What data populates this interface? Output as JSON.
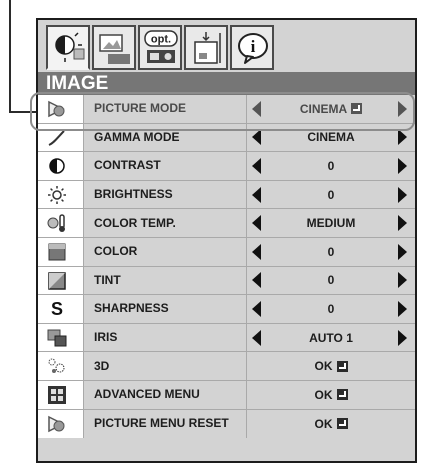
{
  "tabs": [
    {
      "name": "image-tab-icon",
      "active": true
    },
    {
      "name": "screen-tab-icon",
      "active": false
    },
    {
      "name": "option-tab-icon",
      "active": false,
      "label": "opt."
    },
    {
      "name": "setup-tab-icon",
      "active": false
    },
    {
      "name": "info-tab-icon",
      "active": false,
      "label": "i"
    }
  ],
  "header": {
    "title": "IMAGE"
  },
  "rows": [
    {
      "label": "PICTURE MODE",
      "value": "CINEMA",
      "icon": "picture-mode-icon",
      "arrows": true,
      "enter": true,
      "style": "grey"
    },
    {
      "label": "GAMMA MODE",
      "value": "CINEMA",
      "icon": "gamma-mode-icon",
      "arrows": true
    },
    {
      "label": "CONTRAST",
      "value": "0",
      "icon": "contrast-icon",
      "arrows": true
    },
    {
      "label": "BRIGHTNESS",
      "value": "0",
      "icon": "brightness-icon",
      "arrows": true
    },
    {
      "label": "COLOR TEMP.",
      "value": "MEDIUM",
      "icon": "color-temp-icon",
      "arrows": true
    },
    {
      "label": "COLOR",
      "value": "0",
      "icon": "color-icon",
      "arrows": true
    },
    {
      "label": "TINT",
      "value": "0",
      "icon": "tint-icon",
      "arrows": true
    },
    {
      "label": "SHARPNESS",
      "value": "0",
      "icon": "sharpness-icon",
      "arrows": true
    },
    {
      "label": "IRIS",
      "value": "AUTO 1",
      "icon": "iris-icon",
      "arrows": true
    },
    {
      "label": "3D",
      "value": "OK",
      "icon": "3d-icon",
      "enter": true
    },
    {
      "label": "ADVANCED MENU",
      "value": "OK",
      "icon": "advanced-menu-icon",
      "enter": true
    },
    {
      "label": "PICTURE MENU RESET",
      "value": "OK",
      "icon": "picture-menu-reset-icon",
      "enter": true
    }
  ]
}
